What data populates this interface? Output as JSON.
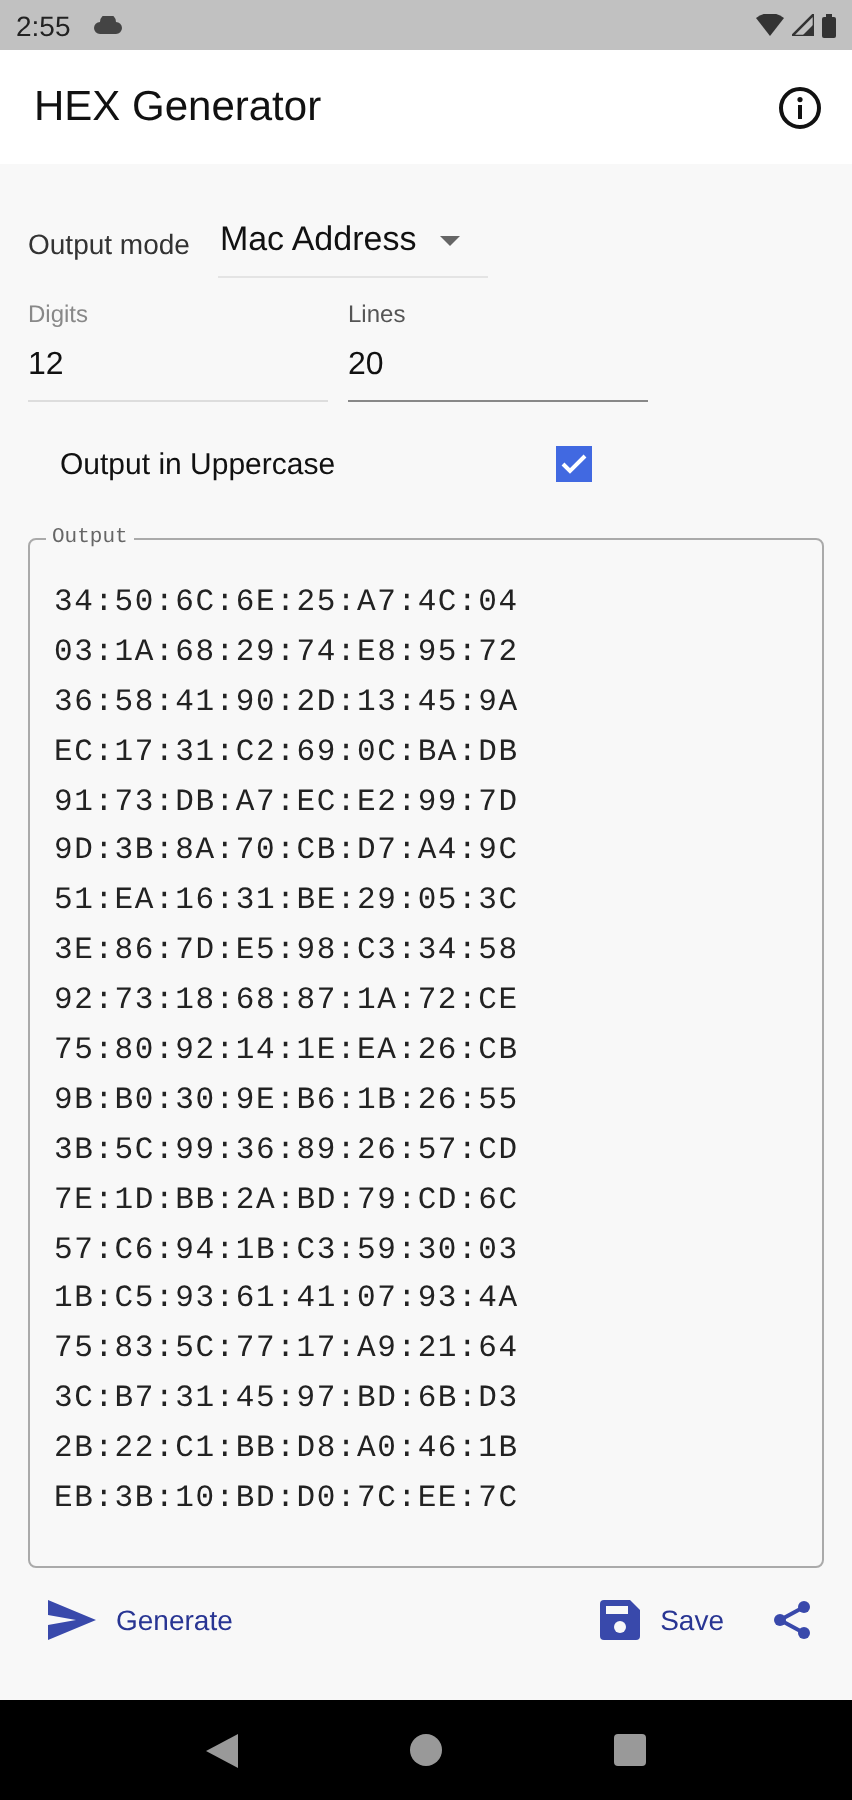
{
  "status_bar": {
    "time": "2:55"
  },
  "app_bar": {
    "title": "HEX Generator"
  },
  "output_mode": {
    "label": "Output mode",
    "value": "Mac Address"
  },
  "fields": [
    {
      "label": "Digits",
      "value": "12",
      "focused": false
    },
    {
      "label": "Lines",
      "value": "20",
      "focused": true
    }
  ],
  "uppercase": {
    "label": "Output in Uppercase",
    "checked": true
  },
  "output": {
    "label": "Output",
    "lines": [
      "34:50:6C:6E:25:A7:4C:04",
      "03:1A:68:29:74:E8:95:72",
      "36:58:41:90:2D:13:45:9A",
      "EC:17:31:C2:69:0C:BA:DB",
      "91:73:DB:A7:EC:E2:99:7D",
      "9D:3B:8A:70:CB:D7:A4:9C",
      "51:EA:16:31:BE:29:05:3C",
      "3E:86:7D:E5:98:C3:34:58",
      "92:73:18:68:87:1A:72:CE",
      "75:80:92:14:1E:EA:26:CB",
      "9B:B0:30:9E:B6:1B:26:55",
      "3B:5C:99:36:89:26:57:CD",
      "7E:1D:BB:2A:BD:79:CD:6C",
      "57:C6:94:1B:C3:59:30:03",
      "1B:C5:93:61:41:07:93:4A",
      "75:83:5C:77:17:A9:21:64",
      "3C:B7:31:45:97:BD:6B:D3",
      "2B:22:C1:BB:D8:A0:46:1B",
      "EB:3B:10:BD:D0:7C:EE:7C"
    ]
  },
  "actions": {
    "generate": "Generate",
    "save": "Save"
  }
}
